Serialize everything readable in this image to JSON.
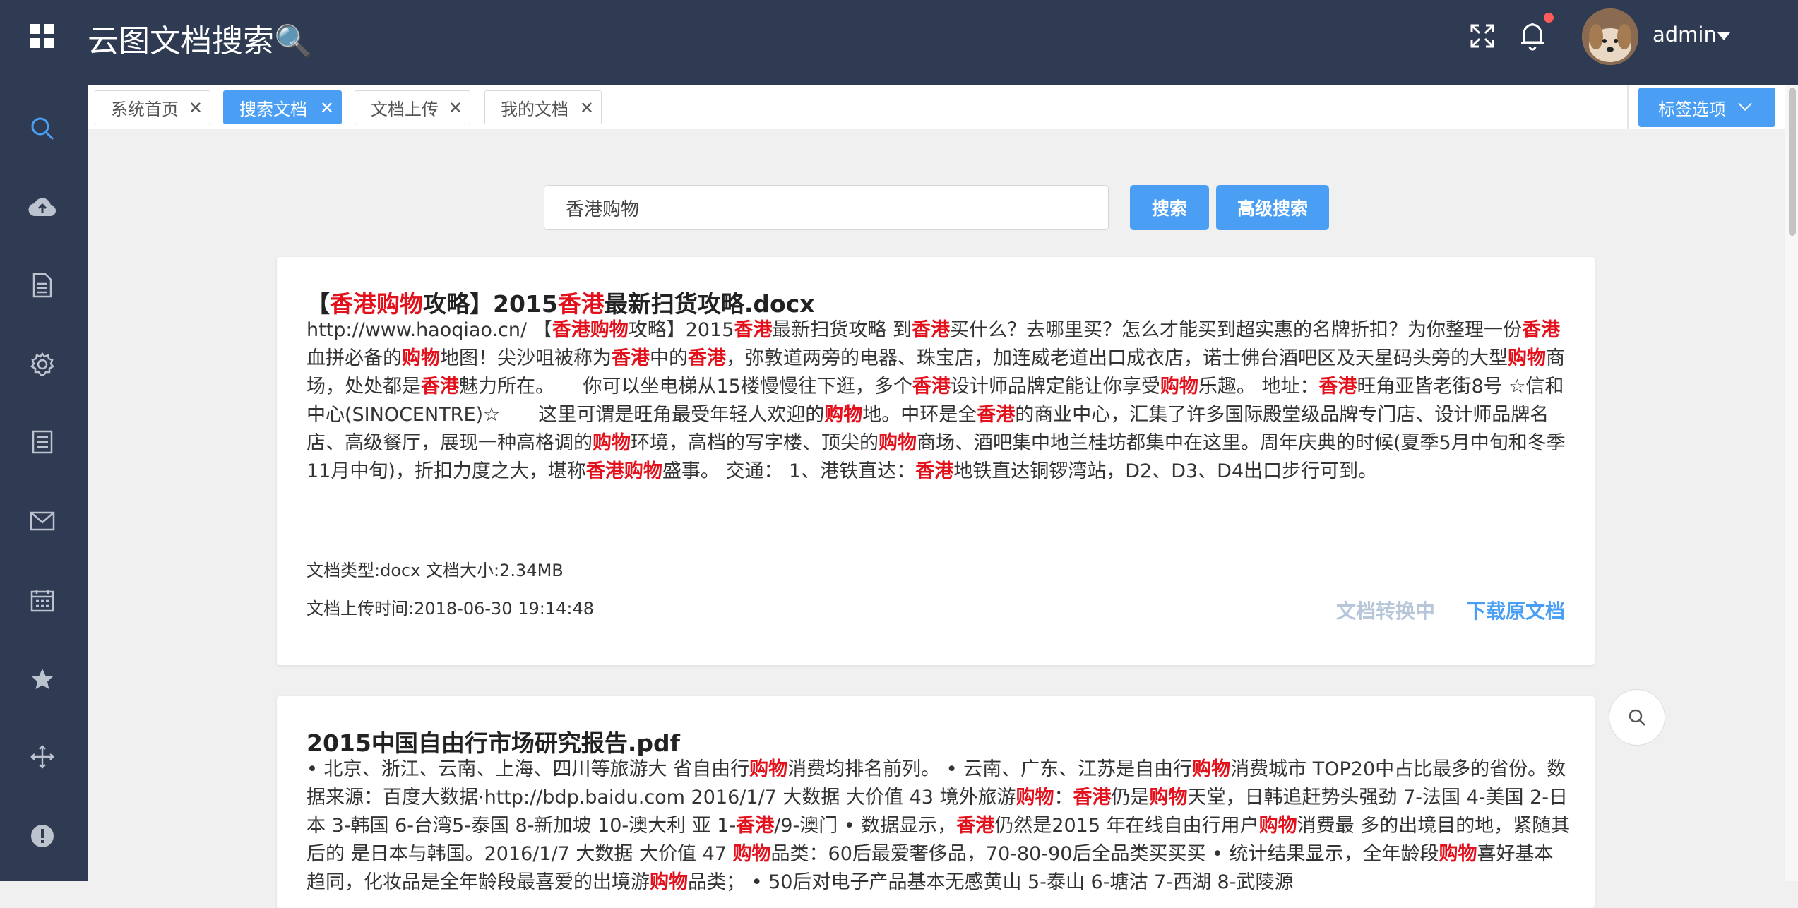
{
  "header": {
    "app_title": "云图文档搜索🔍",
    "username": "admin",
    "icons": [
      "grid-menu-icon",
      "fullscreen-icon",
      "bell-icon",
      "avatar-icon",
      "caret-down-icon"
    ],
    "notification_dot_color": "#ff5b5b"
  },
  "sidebar": {
    "items": [
      {
        "icon": "search-icon"
      },
      {
        "icon": "cloud-upload-icon"
      },
      {
        "icon": "document-icon"
      },
      {
        "icon": "gear-icon"
      },
      {
        "icon": "list-icon"
      },
      {
        "icon": "mail-icon"
      },
      {
        "icon": "calendar-icon"
      },
      {
        "icon": "star-icon"
      },
      {
        "icon": "move-icon"
      },
      {
        "icon": "alert-icon"
      }
    ]
  },
  "tabs": [
    {
      "label": "系统首页",
      "active": false
    },
    {
      "label": "搜索文档",
      "active": true
    },
    {
      "label": "文档上传",
      "active": false
    },
    {
      "label": "我的文档",
      "active": false
    }
  ],
  "tab_options_label": "标签选项",
  "search": {
    "value": "香港购物",
    "search_button": "搜索",
    "advanced_button": "高级搜索"
  },
  "results": [
    {
      "title": "【香港购物攻略】2015香港最新扫货攻略.docx",
      "snippet": "http://www.haoqiao.cn/ 【香港购物攻略】2015香港最新扫货攻略 到香港买什么？去哪里买？怎么才能买到超实惠的名牌折扣？为你整理一份香港血拼必备的购物地图！尖沙咀被称为香港中的香港，弥敦道两旁的电器、珠宝店，加连威老道出口成衣店，诺士佛台酒吧区及天星码头旁的大型购物商场，处处都是香港魅力所在。　　你可以坐电梯从15楼慢慢往下逛，多个香港设计师品牌定能让你享受购物乐趣。 地址：香港旺角亚皆老街8号 ☆信和中心(SINOCENTRE)☆　　这里可谓是旺角最受年轻人欢迎的购物地。中环是全香港的商业中心，汇集了许多国际殿堂级品牌专门店、设计师品牌名店、高级餐厅，展现一种高格调的购物环境，高档的写字楼、顶尖的购物商场、酒吧集中地兰桂坊都集中在这里。周年庆典的时候(夏季5月中旬和冬季11月中旬)，折扣力度之大，堪称香港购物盛事。 交通： 1、港铁直达：香港地铁直达铜锣湾站，D2、D3、D4出口步行可到。",
      "doc_type": "文档类型:docx",
      "doc_size": "文档大小:2.34MB",
      "upload_time": "文档上传时间:2018-06-30 19:14:48",
      "converting_label": "文档转换中",
      "download_label": "下载原文档"
    },
    {
      "title": "2015中国自由行市场研究报告.pdf",
      "snippet": "• 北京、浙江、云南、上海、四川等旅游大 省自由行购物消费均排名前列。 • 云南、广东、江苏是自由行购物消费城市 TOP20中占比最多的省份。数据来源：百度大数据·http://bdp.baidu.com 2016/1/7 大数据 大价值 43 境外旅游购物：香港仍是购物天堂，日韩追赶势头强劲 7-法国 4-美国 2-日本 3-韩国 6-台湾5-泰国 8-新加坡 10-澳大利 亚 1-香港/9-澳门 • 数据显示，香港仍然是2015 年在线自由行用户购物消费最 多的出境目的地，紧随其后的 是日本与韩国。2016/1/7 大数据 大价值 47 购物品类：60后最爱奢侈品，70-80-90后全品类买买买 • 统计结果显示，全年龄段购物喜好基本趋同，化妆品是全年龄段最喜爱的出境游购物品类； • 50后对电子产品基本无感黄山 5-泰山 6-塘沽 7-西湖 8-武陵源"
    }
  ],
  "colors": {
    "topbar_bg": "#2e3b52",
    "accent": "#4a9ff5",
    "highlight": "#e3111c",
    "converting": "#b7c7d9"
  }
}
